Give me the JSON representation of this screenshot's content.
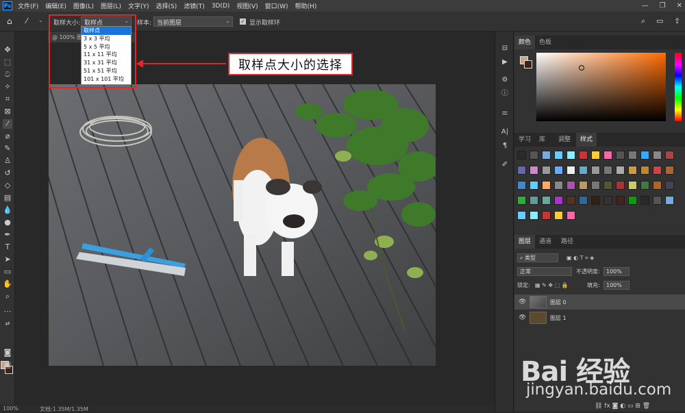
{
  "menubar": {
    "logo": "Ps",
    "items": [
      "文件(F)",
      "编辑(E)",
      "图像(L)",
      "图层(L)",
      "文字(Y)",
      "选择(S)",
      "滤镜(T)",
      "3D(D)",
      "视图(V)",
      "窗口(W)",
      "帮助(H)"
    ],
    "win_min": "—",
    "win_max": "❐",
    "win_close": "✕"
  },
  "options": {
    "size_label": "取样大小:",
    "size_value": "取样点",
    "sample_label": "样本:",
    "sample_value": "当前图层",
    "show_ring_label": "显示取样环"
  },
  "dropdown": {
    "options": [
      "取样点",
      "3 x 3 平均",
      "5 x 5 平均",
      "11 x 11 平均",
      "31 x 31 平均",
      "51 x 51 平均",
      "101 x 101 平均"
    ]
  },
  "annotation": {
    "callout": "取样点大小的选择"
  },
  "document": {
    "tab_label": "@ 100% 图层",
    "status_zoom": "100%",
    "status_doc": "文档:1.35M/1.35M"
  },
  "color_panel": {
    "tabs": [
      "颜色",
      "色板"
    ],
    "fg": "#c9a48b",
    "bg": "#3b2417"
  },
  "styles_panel": {
    "tabs": [
      "学习",
      "库",
      "调整",
      "样式"
    ]
  },
  "layers_panel": {
    "tabs": [
      "图层",
      "通道",
      "路径"
    ],
    "filter_label": "类型",
    "blend_mode": "正常",
    "opacity_label": "不透明度:",
    "opacity_value": "100%",
    "lock_label": "锁定:",
    "fill_label": "填充:",
    "fill_value": "100%",
    "layers": [
      {
        "name": "图层 0"
      },
      {
        "name": "图层 1"
      }
    ]
  },
  "watermark": {
    "brand": "Bai 经验",
    "url": "jingyan.baidu.com"
  }
}
